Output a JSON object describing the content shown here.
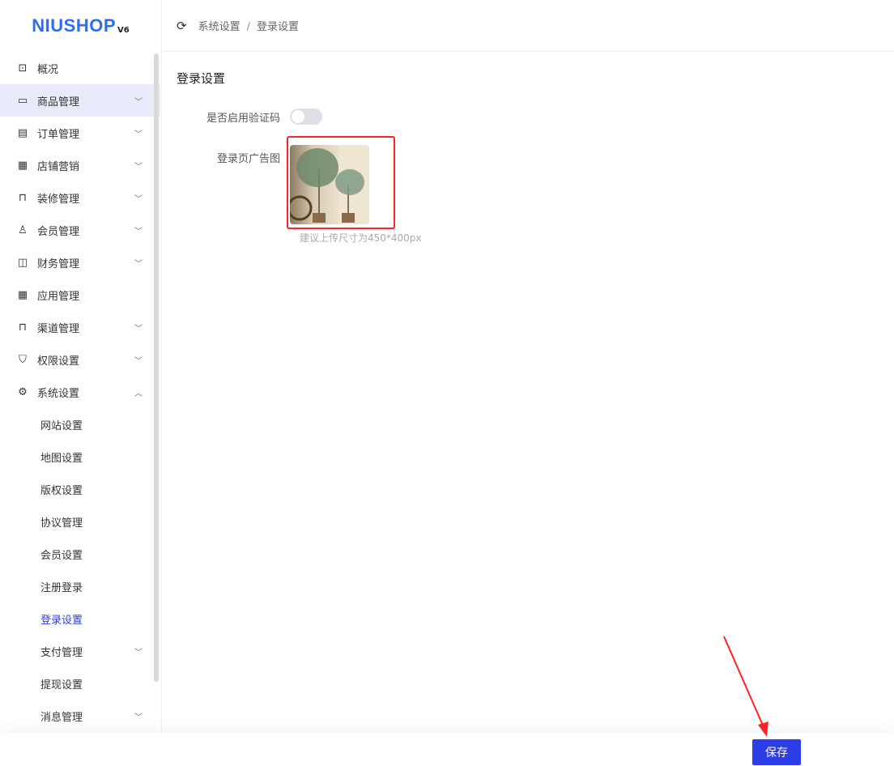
{
  "logo": {
    "brand": "NIUSHOP",
    "version": "V6"
  },
  "header": {
    "breadcrumb": [
      "系统设置",
      "登录设置"
    ],
    "separator": "/"
  },
  "sidebar": {
    "items": [
      {
        "label": "概况",
        "icon": "chart-icon",
        "expandable": false
      },
      {
        "label": "商品管理",
        "icon": "card-icon",
        "expandable": true
      },
      {
        "label": "订单管理",
        "icon": "order-icon",
        "expandable": true
      },
      {
        "label": "店铺营销",
        "icon": "grid-icon",
        "expandable": true
      },
      {
        "label": "装修管理",
        "icon": "brush-icon",
        "expandable": true
      },
      {
        "label": "会员管理",
        "icon": "user-icon",
        "expandable": true
      },
      {
        "label": "财务管理",
        "icon": "wallet-icon",
        "expandable": true
      },
      {
        "label": "应用管理",
        "icon": "apps-icon",
        "expandable": false
      },
      {
        "label": "渠道管理",
        "icon": "channel-icon",
        "expandable": true
      },
      {
        "label": "权限设置",
        "icon": "shield-icon",
        "expandable": true
      },
      {
        "label": "系统设置",
        "icon": "gear-icon",
        "expandable": true
      }
    ],
    "sub_items": [
      {
        "label": "网站设置"
      },
      {
        "label": "地图设置"
      },
      {
        "label": "版权设置"
      },
      {
        "label": "协议管理"
      },
      {
        "label": "会员设置"
      },
      {
        "label": "注册登录"
      },
      {
        "label": "登录设置"
      },
      {
        "label": "支付管理",
        "expandable": true
      },
      {
        "label": "提现设置"
      },
      {
        "label": "消息管理",
        "expandable": true
      }
    ]
  },
  "main": {
    "title": "登录设置",
    "captcha_label": "是否启用验证码",
    "captcha_enabled": false,
    "ad_label": "登录页广告图",
    "ad_tip": "建议上传尺寸为450*400px",
    "save_label": "保存"
  },
  "colors": {
    "accent": "#2b3de6",
    "annotation": "#ff2222"
  }
}
